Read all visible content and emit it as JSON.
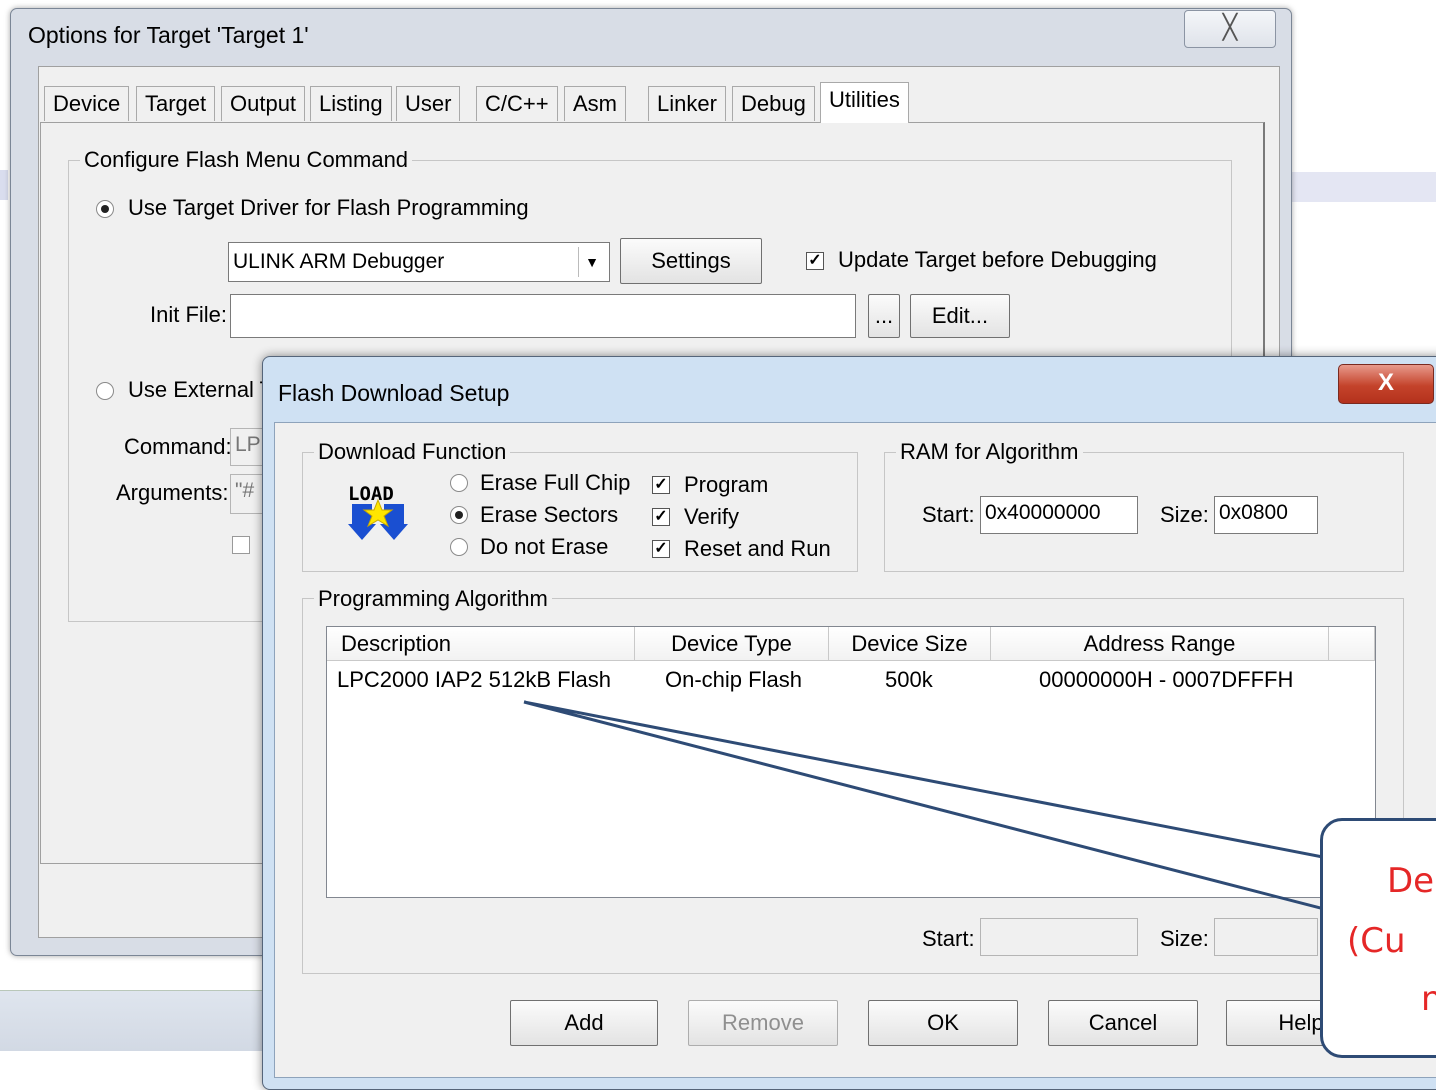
{
  "options_window": {
    "title": "Options for Target 'Target 1'",
    "close_glyph": "╳",
    "tabs": [
      "Device",
      "Target",
      "Output",
      "Listing",
      "User",
      "C/C++",
      "Asm",
      "Linker",
      "Debug",
      "Utilities"
    ],
    "active_tab": "Utilities",
    "configure_group_label": "Configure Flash Menu Command",
    "use_target_driver_label": "Use Target Driver for Flash Programming",
    "driver_select_value": "ULINK ARM Debugger",
    "settings_button": "Settings",
    "update_target_label": "Update Target before Debugging",
    "init_file_label": "Init File:",
    "init_file_value": "",
    "browse_button": "...",
    "edit_button": "Edit...",
    "use_external_label": "Use External T",
    "command_label": "Command:",
    "command_value": "LP",
    "arguments_label": "Arguments:",
    "arguments_value": "\"#"
  },
  "flash_dialog": {
    "title": "Flash Download Setup",
    "close_glyph": "X",
    "download_group_label": "Download Function",
    "load_icon_text": "LOAD",
    "erase_options": [
      "Erase Full Chip",
      "Erase Sectors",
      "Do not Erase"
    ],
    "erase_selected": "Erase Sectors",
    "checks": [
      "Program",
      "Verify",
      "Reset and Run"
    ],
    "ram_group_label": "RAM for Algorithm",
    "ram_start_label": "Start:",
    "ram_start_value": "0x40000000",
    "ram_size_label": "Size:",
    "ram_size_value": "0x0800",
    "algo_group_label": "Programming Algorithm",
    "columns": [
      "Description",
      "Device Type",
      "Device Size",
      "Address Range"
    ],
    "rows": [
      {
        "description": "LPC2000 IAP2 512kB Flash",
        "device_type": "On-chip Flash",
        "device_size": "500k",
        "address_range": "00000000H - 0007DFFFH"
      }
    ],
    "algo_start_label": "Start:",
    "algo_size_label": "Size:",
    "buttons": {
      "add": "Add",
      "remove": "Remove",
      "ok": "OK",
      "cancel": "Cancel",
      "help": "Help"
    }
  },
  "callout": {
    "line1": "De",
    "line2": "(Cu",
    "line3": "n",
    "text_color": "#e52727",
    "border_color": "#2e4b75"
  }
}
